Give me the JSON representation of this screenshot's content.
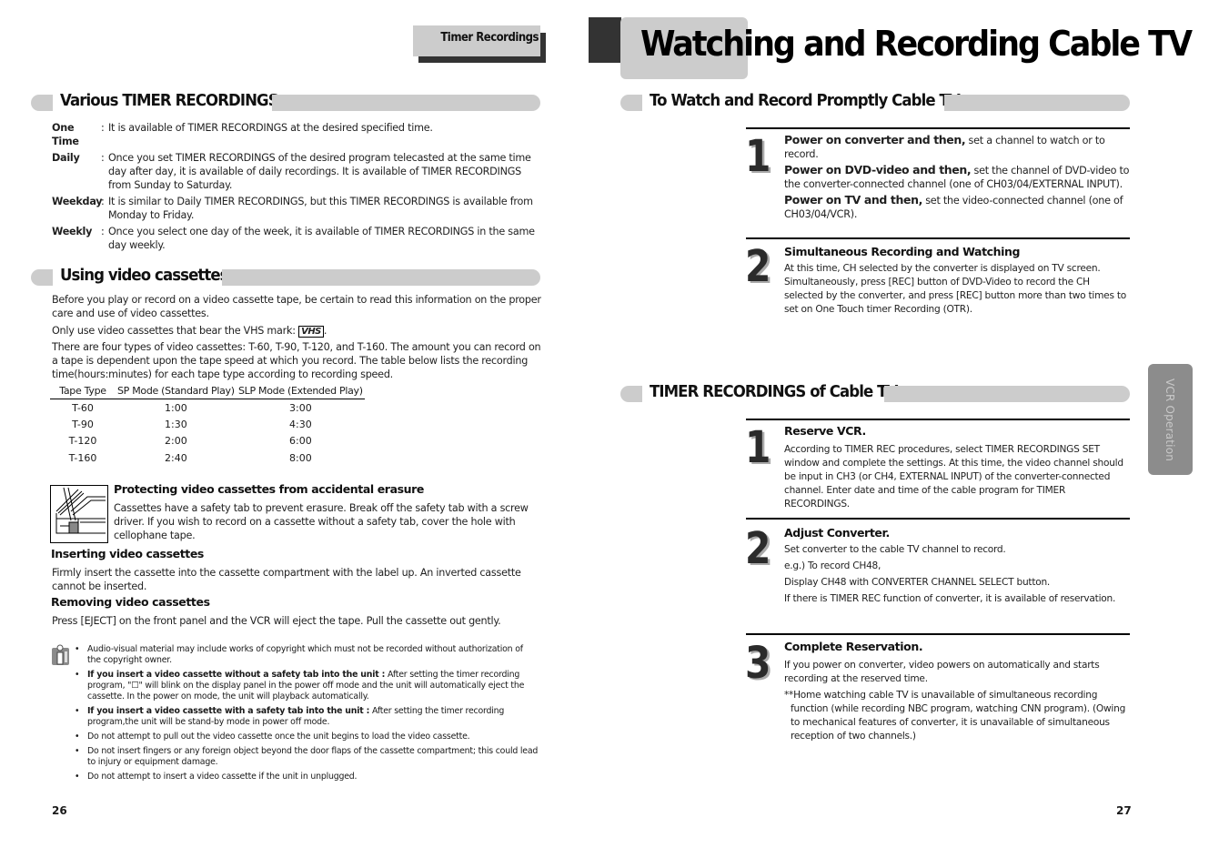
{
  "header": {
    "left_tab": "Timer Recordings",
    "title": "Watching and Recording Cable TV"
  },
  "left_page": {
    "timer_section": {
      "heading": "Various TIMER RECORDINGS",
      "items": [
        {
          "term": "One Time",
          "desc": "It is available of TIMER RECORDINGS at the desired specified time."
        },
        {
          "term": "Daily",
          "desc": "Once you set TIMER RECORDINGS of the desired program telecasted at the same time day after day, it is available of daily recordings. It is available of TIMER RECORDINGS from Sunday to Saturday."
        },
        {
          "term": "Weekday",
          "desc": "It is similar to Daily TIMER RECORDINGS, but this TIMER RECORDINGS is available from Monday to Friday."
        },
        {
          "term": "Weekly",
          "desc": "Once you select one day of the week, it is available of TIMER RECORDINGS in the same day weekly."
        }
      ]
    },
    "cassette_section": {
      "heading": "Using video cassettes",
      "intro": "Before you play or record on a video cassette tape, be certain to read this information on the proper care and use of video cassettes.",
      "vhs_text": "Only use video cassettes that bear the VHS mark:",
      "vhs_mark": "VHS",
      "types_text": "There are four types of  video cassettes: T-60, T-90, T-120, and T-160. The amount you can record on a tape is dependent upon the tape speed at which you record. The table below lists the recording time(hours:minutes) for each tape type according to recording speed.",
      "table": {
        "headers": [
          "Tape Type",
          "SP Mode (Standard Play)",
          "SLP Mode (Extended Play)"
        ],
        "rows": [
          [
            "T-60",
            "1:00",
            "3:00"
          ],
          [
            "T-90",
            "1:30",
            "4:30"
          ],
          [
            "T-120",
            "2:00",
            "6:00"
          ],
          [
            "T-160",
            "2:40",
            "8:00"
          ]
        ]
      },
      "protect_heading": "Protecting video cassettes from accidental erasure",
      "protect_text": "Cassettes have a safety tab to prevent erasure. Break off  the safety tab  with a screw driver. If you wish to record on a cassette without a safety tab, cover the hole with cellophane  tape.",
      "insert_heading": "Inserting video cassettes",
      "insert_text": "Firmly insert the cassette into the cassette compartment with the label up. An inverted cassette cannot be inserted.",
      "remove_heading": "Removing video cassettes",
      "remove_text": "Press [EJECT] on the front panel and the VCR will eject the tape. Pull the cassette out gently."
    },
    "notes": [
      {
        "bold": "",
        "text": "Audio-visual material may include works of copyright which must not be recorded without authorization of the copyright owner."
      },
      {
        "bold": "If you insert a video cassette without a safety tab into the unit :",
        "text": " After setting the timer recording program, \"☐\" will blink on the display panel in the power off mode and the unit will automatically eject the cassette. In the power on mode, the  unit will playback automatically."
      },
      {
        "bold": "If you insert a video cassette with a safety tab into the unit :",
        "text": " After setting the timer  recording program,the unit will be stand-by mode in power off mode."
      },
      {
        "bold": "",
        "text": "Do not  attempt to pull out  the video cassette once the unit begins to load the  video cassette."
      },
      {
        "bold": "",
        "text": "Do not insert fingers or  any foreign object  beyond the door flaps of  the cassette compartment; this could lead to injury or  equipment damage."
      },
      {
        "bold": "",
        "text": "Do not attempt to insert a video cassette if the unit in unplugged."
      }
    ],
    "page_number": "26"
  },
  "right_page": {
    "watch_section": {
      "heading": "To Watch and Record Promptly Cable TV",
      "steps": [
        {
          "number": "1",
          "parts": [
            {
              "lead": "Power on converter and then,",
              "text": " set a channel to watch or to record."
            },
            {
              "lead": "Power on DVD-video and then,",
              "text": " set the channel of DVD-video to the converter-connected channel (one of CH03/04/EXTERNAL INPUT)."
            },
            {
              "lead": "Power on TV and then,",
              "text": " set the video-connected channel (one of CH03/04/VCR)."
            }
          ]
        },
        {
          "number": "2",
          "title": "Simultaneous Recording and Watching",
          "text": "At this time, CH selected by the converter is displayed on TV screen. Simultaneously, press [REC] button of DVD-Video to record the CH selected by the converter, and press [REC] button more than two times to set on One Touch timer Recording (OTR)."
        }
      ]
    },
    "timer_section": {
      "heading": "TIMER RECORDINGS of Cable TV",
      "steps": [
        {
          "number": "1",
          "title": "Reserve VCR.",
          "lines": [
            "According to TIMER REC procedures, select TIMER RECORDINGS SET window and complete the  settings. At this time, the video channel should be input in CH3 (or CH4, EXTERNAL INPUT) of the converter-connected channel. Enter date and time of the cable program for TIMER RECORDINGS."
          ]
        },
        {
          "number": "2",
          "title": "Adjust Converter.",
          "lines": [
            "Set converter to the cable TV channel to record.",
            "e.g.) To record CH48,",
            "Display CH48 with CONVERTER CHANNEL SELECT button.",
            "If there is TIMER REC function of converter, it is available of reservation."
          ]
        },
        {
          "number": "3",
          "title": "Complete Reservation.",
          "lines": [
            "If you power on converter, video powers on automatically and starts recording at the reserved time.",
            "**Home watching cable TV is unavailable of simultaneous recording function (while recording NBC program, watching CNN program). (Owing to mechanical features of converter, it is unavailable of simultaneous reception of two channels.)"
          ]
        }
      ]
    },
    "side_tab": "VCR Operation",
    "page_number": "27"
  },
  "colors": {
    "accent_grey": "#cccccc",
    "dark_block": "#333333",
    "side_tab": "#8c8c8c"
  }
}
